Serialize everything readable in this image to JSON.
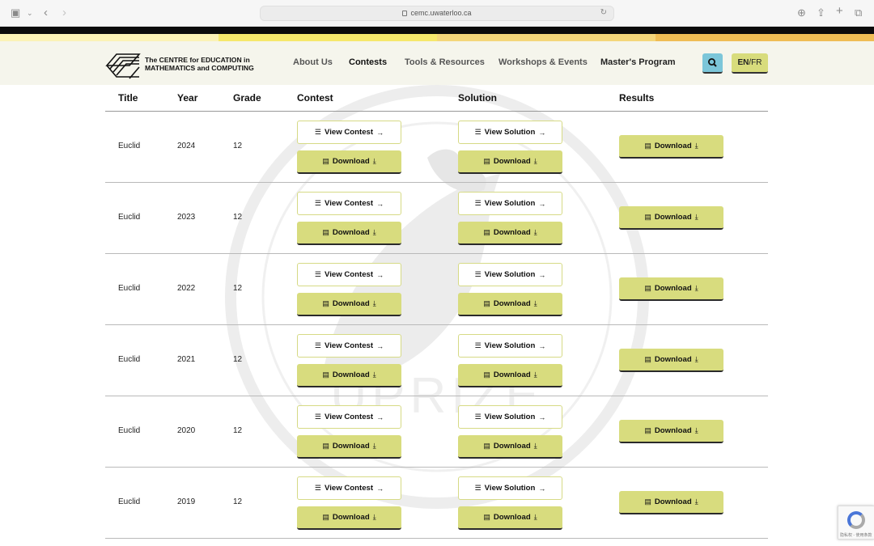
{
  "browser": {
    "url": "cemc.uwaterloo.ca"
  },
  "colors": {
    "stripe": [
      "#fbf2b6",
      "#f6e86c",
      "#f4d67a",
      "#efbd55"
    ],
    "button_fill": "#d8dc7e",
    "search_button": "#7cc6d9"
  },
  "header": {
    "logo_line1": "The CENTRE for EDUCATION in",
    "logo_line2": "MATHEMATICS and COMPUTING",
    "nav": [
      "About Us",
      "Contests",
      "Tools & Resources",
      "Workshops & Events",
      "Master's Program"
    ],
    "active_nav": "Contests",
    "lang_en": "EN",
    "lang_sep": "/",
    "lang_fr": "FR"
  },
  "table": {
    "headers": [
      "Title",
      "Year",
      "Grade",
      "Contest",
      "Solution",
      "Results"
    ],
    "view_contest_label": "View Contest",
    "view_solution_label": "View Solution",
    "download_label": "Download",
    "rows": [
      {
        "title": "Euclid",
        "year": "2024",
        "grade": "12"
      },
      {
        "title": "Euclid",
        "year": "2023",
        "grade": "12"
      },
      {
        "title": "Euclid",
        "year": "2022",
        "grade": "12"
      },
      {
        "title": "Euclid",
        "year": "2021",
        "grade": "12"
      },
      {
        "title": "Euclid",
        "year": "2020",
        "grade": "12"
      },
      {
        "title": "Euclid",
        "year": "2019",
        "grade": "12"
      }
    ]
  },
  "watermark_text": "UPRIZE",
  "recaptcha_text": "隐私权 - 使用条款"
}
